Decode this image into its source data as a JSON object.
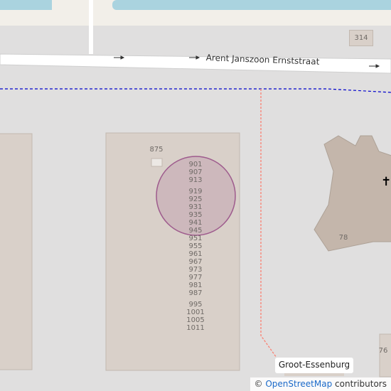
{
  "map": {
    "street_name": "Arent Janszoon Ernststraat",
    "place_label": "Groot-Essenburg",
    "route_ref": "314",
    "house_numbers": {
      "n875": "875",
      "n78": "78",
      "n76": "76",
      "column": [
        "901",
        "907",
        "913",
        "919",
        "925",
        "931",
        "935",
        "941",
        "945",
        "951",
        "955",
        "961",
        "967",
        "973",
        "977",
        "981",
        "987",
        "995",
        "1001",
        "1005",
        "1011"
      ]
    },
    "icons": {
      "church": "church-icon",
      "oneway": "oneway-arrow-icon"
    },
    "colors": {
      "land": "#e0dfdf",
      "water": "#aad3df",
      "building": "#d9d0c9",
      "church": "#c4b6ab",
      "road": "#ffffff",
      "footway": "#fa8072",
      "boundary": "#0000cc",
      "highlight": "#9e5b8d"
    }
  },
  "attribution": {
    "copy": "©",
    "link": "OpenStreetMap",
    "suffix": " contributors"
  }
}
